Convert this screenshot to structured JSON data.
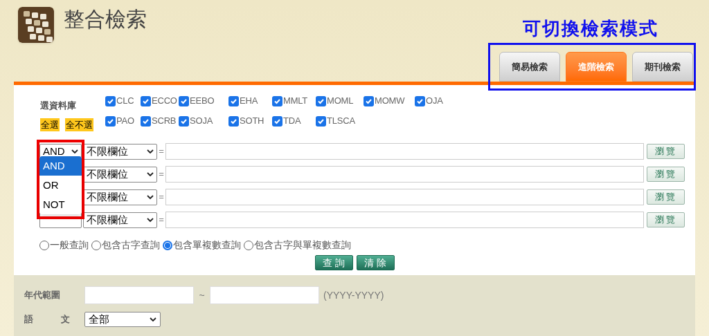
{
  "header": {
    "title": "整合檢索"
  },
  "annotation": {
    "text": "可切換檢索模式"
  },
  "tabs": [
    {
      "label": "簡易檢索",
      "selected": false
    },
    {
      "label": "進階檢索",
      "selected": true
    },
    {
      "label": "期刊檢索",
      "selected": false
    }
  ],
  "databases": {
    "label": "選資料庫",
    "select_all": "全選",
    "select_none": "全不選",
    "items": [
      {
        "label": "CLC",
        "checked": true
      },
      {
        "label": "ECCO",
        "checked": true
      },
      {
        "label": "EEBO",
        "checked": true
      },
      {
        "label": "EHA",
        "checked": true
      },
      {
        "label": "MMLT",
        "checked": true
      },
      {
        "label": "MOML",
        "checked": true
      },
      {
        "label": "MOMW",
        "checked": true
      },
      {
        "label": "OJA",
        "checked": true
      },
      {
        "label": "PAO",
        "checked": true
      },
      {
        "label": "SCRB",
        "checked": true
      },
      {
        "label": "SOJA",
        "checked": true
      },
      {
        "label": "SOTH",
        "checked": true
      },
      {
        "label": "TDA",
        "checked": true
      },
      {
        "label": "TLSCA",
        "checked": true
      }
    ]
  },
  "search_rows": [
    {
      "operator": "AND",
      "field": "不限欄位",
      "separator": "=",
      "button": "瀏覽"
    },
    {
      "field": "不限欄位",
      "separator": "=",
      "button": "瀏覽"
    },
    {
      "field": "不限欄位",
      "separator": "=",
      "button": "瀏覽"
    },
    {
      "field": "不限欄位",
      "separator": "=",
      "button": "瀏覽"
    }
  ],
  "operator_dropdown": {
    "options": [
      {
        "label": "AND",
        "selected": true
      },
      {
        "label": "OR",
        "selected": false
      },
      {
        "label": "NOT",
        "selected": false
      }
    ]
  },
  "query_modes": [
    {
      "label": "一般查詢",
      "selected": false
    },
    {
      "label": "包含古字查詢",
      "selected": false
    },
    {
      "label": "包含單複數查詢",
      "selected": true
    },
    {
      "label": "包含古字與單複數查詢",
      "selected": false
    }
  ],
  "actions": [
    "查 詢",
    "清 除"
  ],
  "filters": {
    "year_range": {
      "label": "年代範圍",
      "separator": "~",
      "hint": "(YYYY-YYYY)"
    },
    "language": {
      "label": "語 文",
      "value": "全部"
    }
  }
}
